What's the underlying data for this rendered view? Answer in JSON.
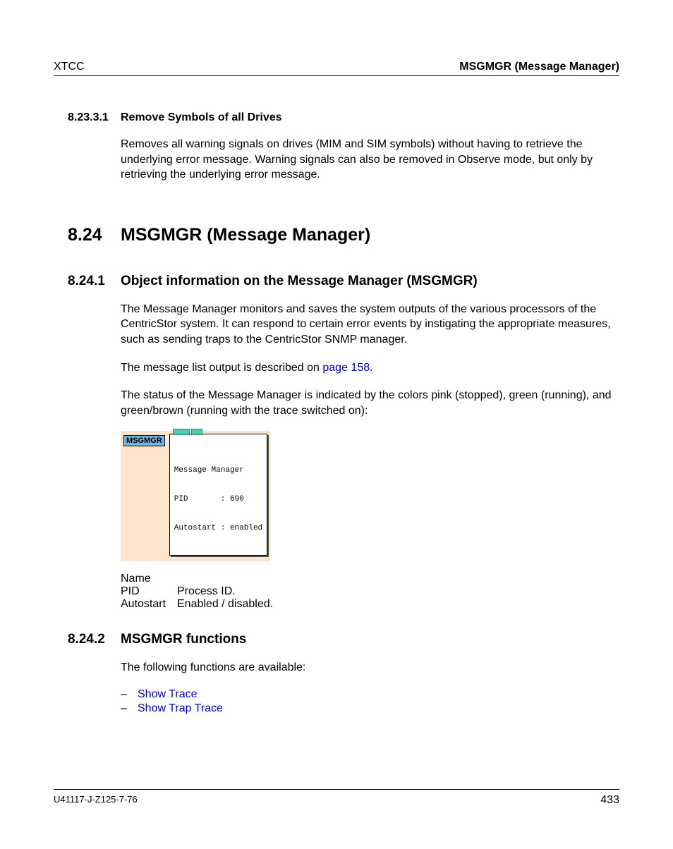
{
  "header": {
    "left": "XTCC",
    "right": "MSGMGR (Message Manager)"
  },
  "sec_8_23_3_1": {
    "num": "8.23.3.1",
    "title": "Remove Symbols of all Drives",
    "body": "Removes all warning signals on drives (MIM and SIM symbols) without having to retrieve the underlying error message. Warning signals can also be removed in Observe mode, but only by retrieving the underlying error message."
  },
  "sec_8_24": {
    "num": "8.24",
    "title": "MSGMGR (Message Manager)"
  },
  "sec_8_24_1": {
    "num": "8.24.1",
    "title": "Object information on the Message Manager (MSGMGR)",
    "p1": "The Message Manager monitors and saves the system outputs of the various processors of the CentricStor system. It can respond to certain error events by instigating the appropriate measures, such as sending traps to the CentricStor SNMP manager.",
    "p2_a": "The message list output is described on ",
    "p2_link": "page 158",
    "p2_b": ".",
    "p3": "The status of the Message Manager is indicated by the colors pink (stopped), green (running), and green/brown (running with the trace switched on):"
  },
  "figure": {
    "label": "MSGMGR",
    "tooltip_l1": "Message Manager",
    "tooltip_l2": "PID       : 690",
    "tooltip_l3": "Autostart : enabled"
  },
  "defs": {
    "r1_term": "Name",
    "r1_desc": "",
    "r2_term": "PID",
    "r2_desc": "Process ID.",
    "r3_term": "Autostart",
    "r3_desc": "Enabled / disabled."
  },
  "sec_8_24_2": {
    "num": "8.24.2",
    "title": "MSGMGR functions",
    "intro": "The following functions are available:",
    "b1": "Show Trace",
    "b2": "Show Trap Trace"
  },
  "footer": {
    "left": "U41117-J-Z125-7-76",
    "right": "433"
  }
}
